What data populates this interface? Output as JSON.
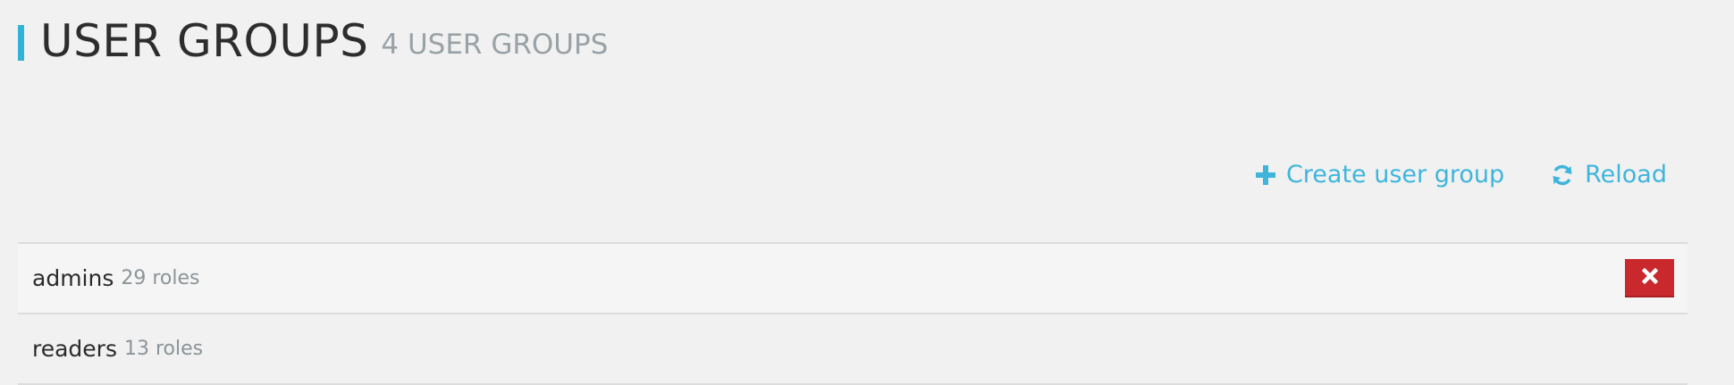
{
  "header": {
    "title": "USER GROUPS",
    "subtitle": "4 USER GROUPS",
    "accent_color": "#30b3d4"
  },
  "toolbar": {
    "create_label": "Create user group",
    "create_icon": "plus-icon",
    "reload_label": "Reload",
    "reload_icon": "refresh-icon",
    "link_color": "#3fb5dc"
  },
  "groups": [
    {
      "name": "admins",
      "count": "29 roles",
      "delete_icon": "close-icon"
    },
    {
      "name": "readers",
      "count": "13 roles"
    }
  ],
  "colors": {
    "background": "#f1f1f1",
    "delete_button": "#c9282d"
  }
}
